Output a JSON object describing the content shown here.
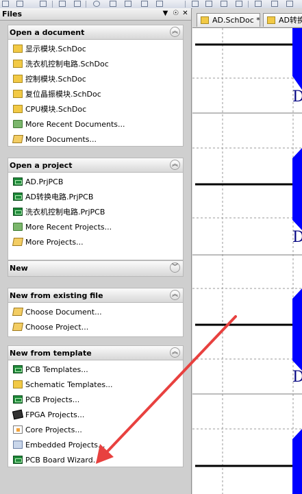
{
  "files_panel": {
    "title": "Files",
    "header_controls": {
      "dropdown": "▼",
      "pin": "☉",
      "close": "✕"
    },
    "sections": [
      {
        "title": "Open a document",
        "collapse_glyph": "︽",
        "items": [
          {
            "label": "显示模块.SchDoc",
            "icon": "schematic-document-icon"
          },
          {
            "label": "洗衣机控制电路.SchDoc",
            "icon": "schematic-document-icon"
          },
          {
            "label": "控制模块.SchDoc",
            "icon": "schematic-document-icon"
          },
          {
            "label": "复位晶振模块.SchDoc",
            "icon": "schematic-document-icon"
          },
          {
            "label": "CPU模块.SchDoc",
            "icon": "schematic-document-icon"
          },
          {
            "label": "More Recent Documents...",
            "icon": "recent-folder-icon"
          },
          {
            "label": "More Documents...",
            "icon": "open-folder-icon"
          }
        ]
      },
      {
        "title": "Open a project",
        "collapse_glyph": "︽",
        "items": [
          {
            "label": "AD.PrjPCB",
            "icon": "pcb-project-icon"
          },
          {
            "label": "AD转换电路.PrjPCB",
            "icon": "pcb-project-icon"
          },
          {
            "label": "洗衣机控制电路.PrjPCB",
            "icon": "pcb-project-icon"
          },
          {
            "label": "More Recent Projects...",
            "icon": "recent-folder-icon"
          },
          {
            "label": "More Projects...",
            "icon": "open-folder-icon"
          }
        ]
      },
      {
        "title": "New",
        "collapse_glyph": "︾",
        "items": []
      },
      {
        "title": "New from existing file",
        "collapse_glyph": "︽",
        "items": [
          {
            "label": "Choose Document...",
            "icon": "open-folder-icon"
          },
          {
            "label": "Choose Project...",
            "icon": "open-folder-icon"
          }
        ]
      },
      {
        "title": "New from template",
        "collapse_glyph": "︽",
        "items": [
          {
            "label": "PCB Templates...",
            "icon": "pcb-icon"
          },
          {
            "label": "Schematic Templates...",
            "icon": "schematic-document-icon"
          },
          {
            "label": "PCB Projects...",
            "icon": "pcb-project-icon"
          },
          {
            "label": "FPGA Projects...",
            "icon": "fpga-chip-icon"
          },
          {
            "label": "Core Projects...",
            "icon": "core-project-icon"
          },
          {
            "label": "Embedded Projects...",
            "icon": "embedded-project-icon"
          },
          {
            "label": "PCB Board Wizard...",
            "icon": "pcb-icon"
          }
        ]
      }
    ]
  },
  "editor": {
    "tabs": [
      {
        "label": "AD.SchDoc *",
        "icon": "schematic-document-icon"
      },
      {
        "label": "AD转换",
        "icon": "schematic-document-icon"
      }
    ],
    "pin_letter": "D"
  },
  "colors": {
    "annotation_arrow": "#e8413f",
    "wire": "#000000",
    "component_blue": "#0000ff",
    "grid": "#9a9a9a"
  }
}
